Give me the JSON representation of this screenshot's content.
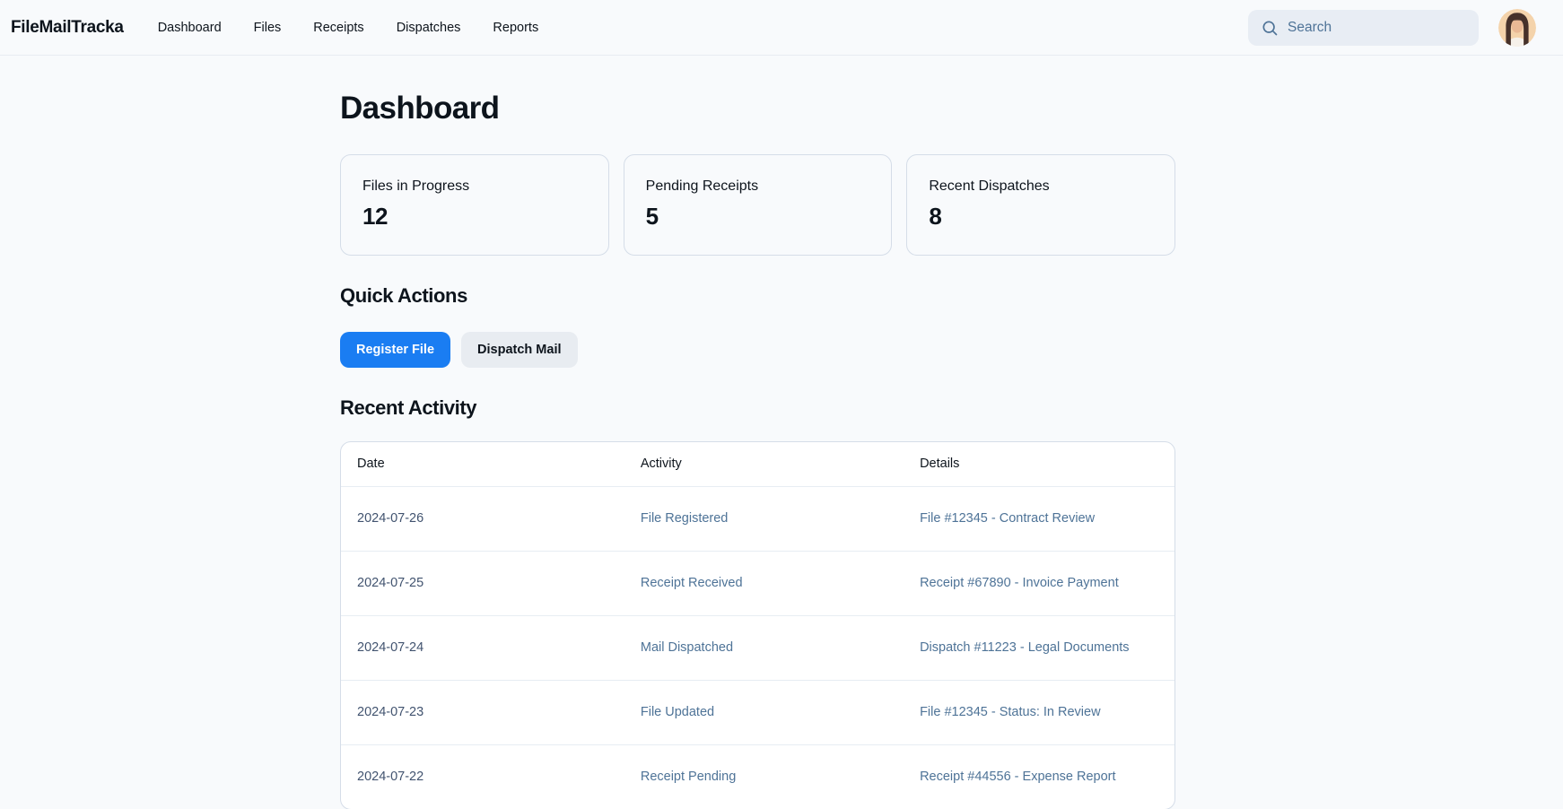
{
  "header": {
    "logo": "FileMailTracka",
    "nav": [
      "Dashboard",
      "Files",
      "Receipts",
      "Dispatches",
      "Reports"
    ],
    "search_placeholder": "Search"
  },
  "page": {
    "title": "Dashboard"
  },
  "stats": [
    {
      "label": "Files in Progress",
      "value": "12"
    },
    {
      "label": "Pending Receipts",
      "value": "5"
    },
    {
      "label": "Recent Dispatches",
      "value": "8"
    }
  ],
  "quick_actions": {
    "heading": "Quick Actions",
    "primary_label": "Register File",
    "secondary_label": "Dispatch Mail"
  },
  "recent_activity": {
    "heading": "Recent Activity",
    "columns": [
      "Date",
      "Activity",
      "Details"
    ],
    "rows": [
      {
        "date": "2024-07-26",
        "activity": "File Registered",
        "details": "File #12345 - Contract Review"
      },
      {
        "date": "2024-07-25",
        "activity": "Receipt Received",
        "details": "Receipt #67890 - Invoice Payment"
      },
      {
        "date": "2024-07-24",
        "activity": "Mail Dispatched",
        "details": "Dispatch #11223 - Legal Documents"
      },
      {
        "date": "2024-07-23",
        "activity": "File Updated",
        "details": "File #12345 - Status: In Review"
      },
      {
        "date": "2024-07-22",
        "activity": "Receipt Pending",
        "details": "Receipt #44556 - Expense Report"
      }
    ]
  },
  "colors": {
    "primary_blue": "#1a7df2",
    "page_background": "#f8fafc",
    "muted_slate_text": "#4e7397",
    "card_border": "#d5dde8",
    "search_background": "#e8edf4"
  }
}
